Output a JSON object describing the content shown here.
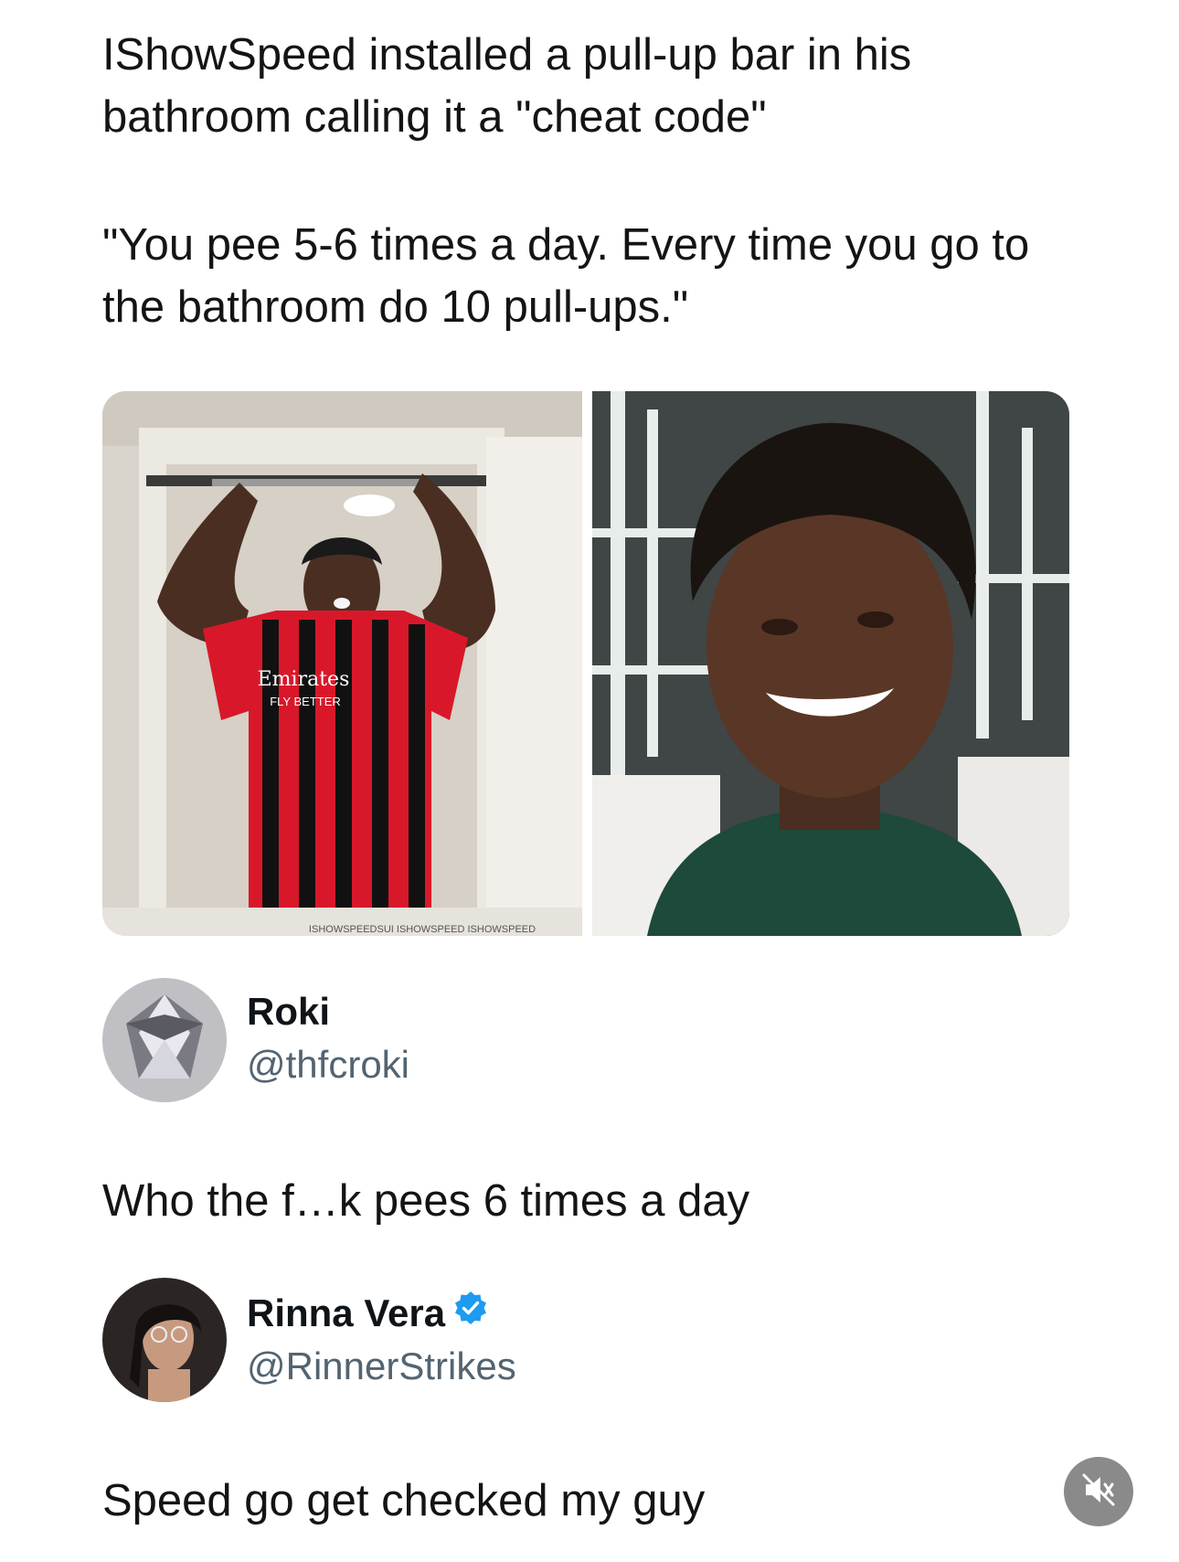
{
  "post": {
    "headline": "IShowSpeed installed a pull-up bar in his bathroom calling it a \"cheat code\"",
    "quote": "\"You pee 5-6 times a day. Every time you go to the bathroom do 10 pull-ups.\""
  },
  "photos": {
    "left": {
      "jersey_text": "Emirates",
      "jersey_subtext": "FLY BETTER",
      "watermark": "ISHOWSPEEDSUI  ISHOWSPEED  ISHOWSPEED"
    }
  },
  "replies": [
    {
      "name": "Roki",
      "handle": "@thfcroki",
      "text": "Who the f…k pees 6 times a day",
      "verified": false
    },
    {
      "name": "Rinna Vera",
      "handle": "@RinnerStrikes",
      "text": "Speed go get checked my guy",
      "verified": true
    }
  ],
  "icons": {
    "mute": "speaker-muted-icon",
    "verified": "verified-badge-icon"
  },
  "colors": {
    "verified": "#1d9bf0",
    "handle": "#536471",
    "mute_bg": "#8a8a8a"
  }
}
